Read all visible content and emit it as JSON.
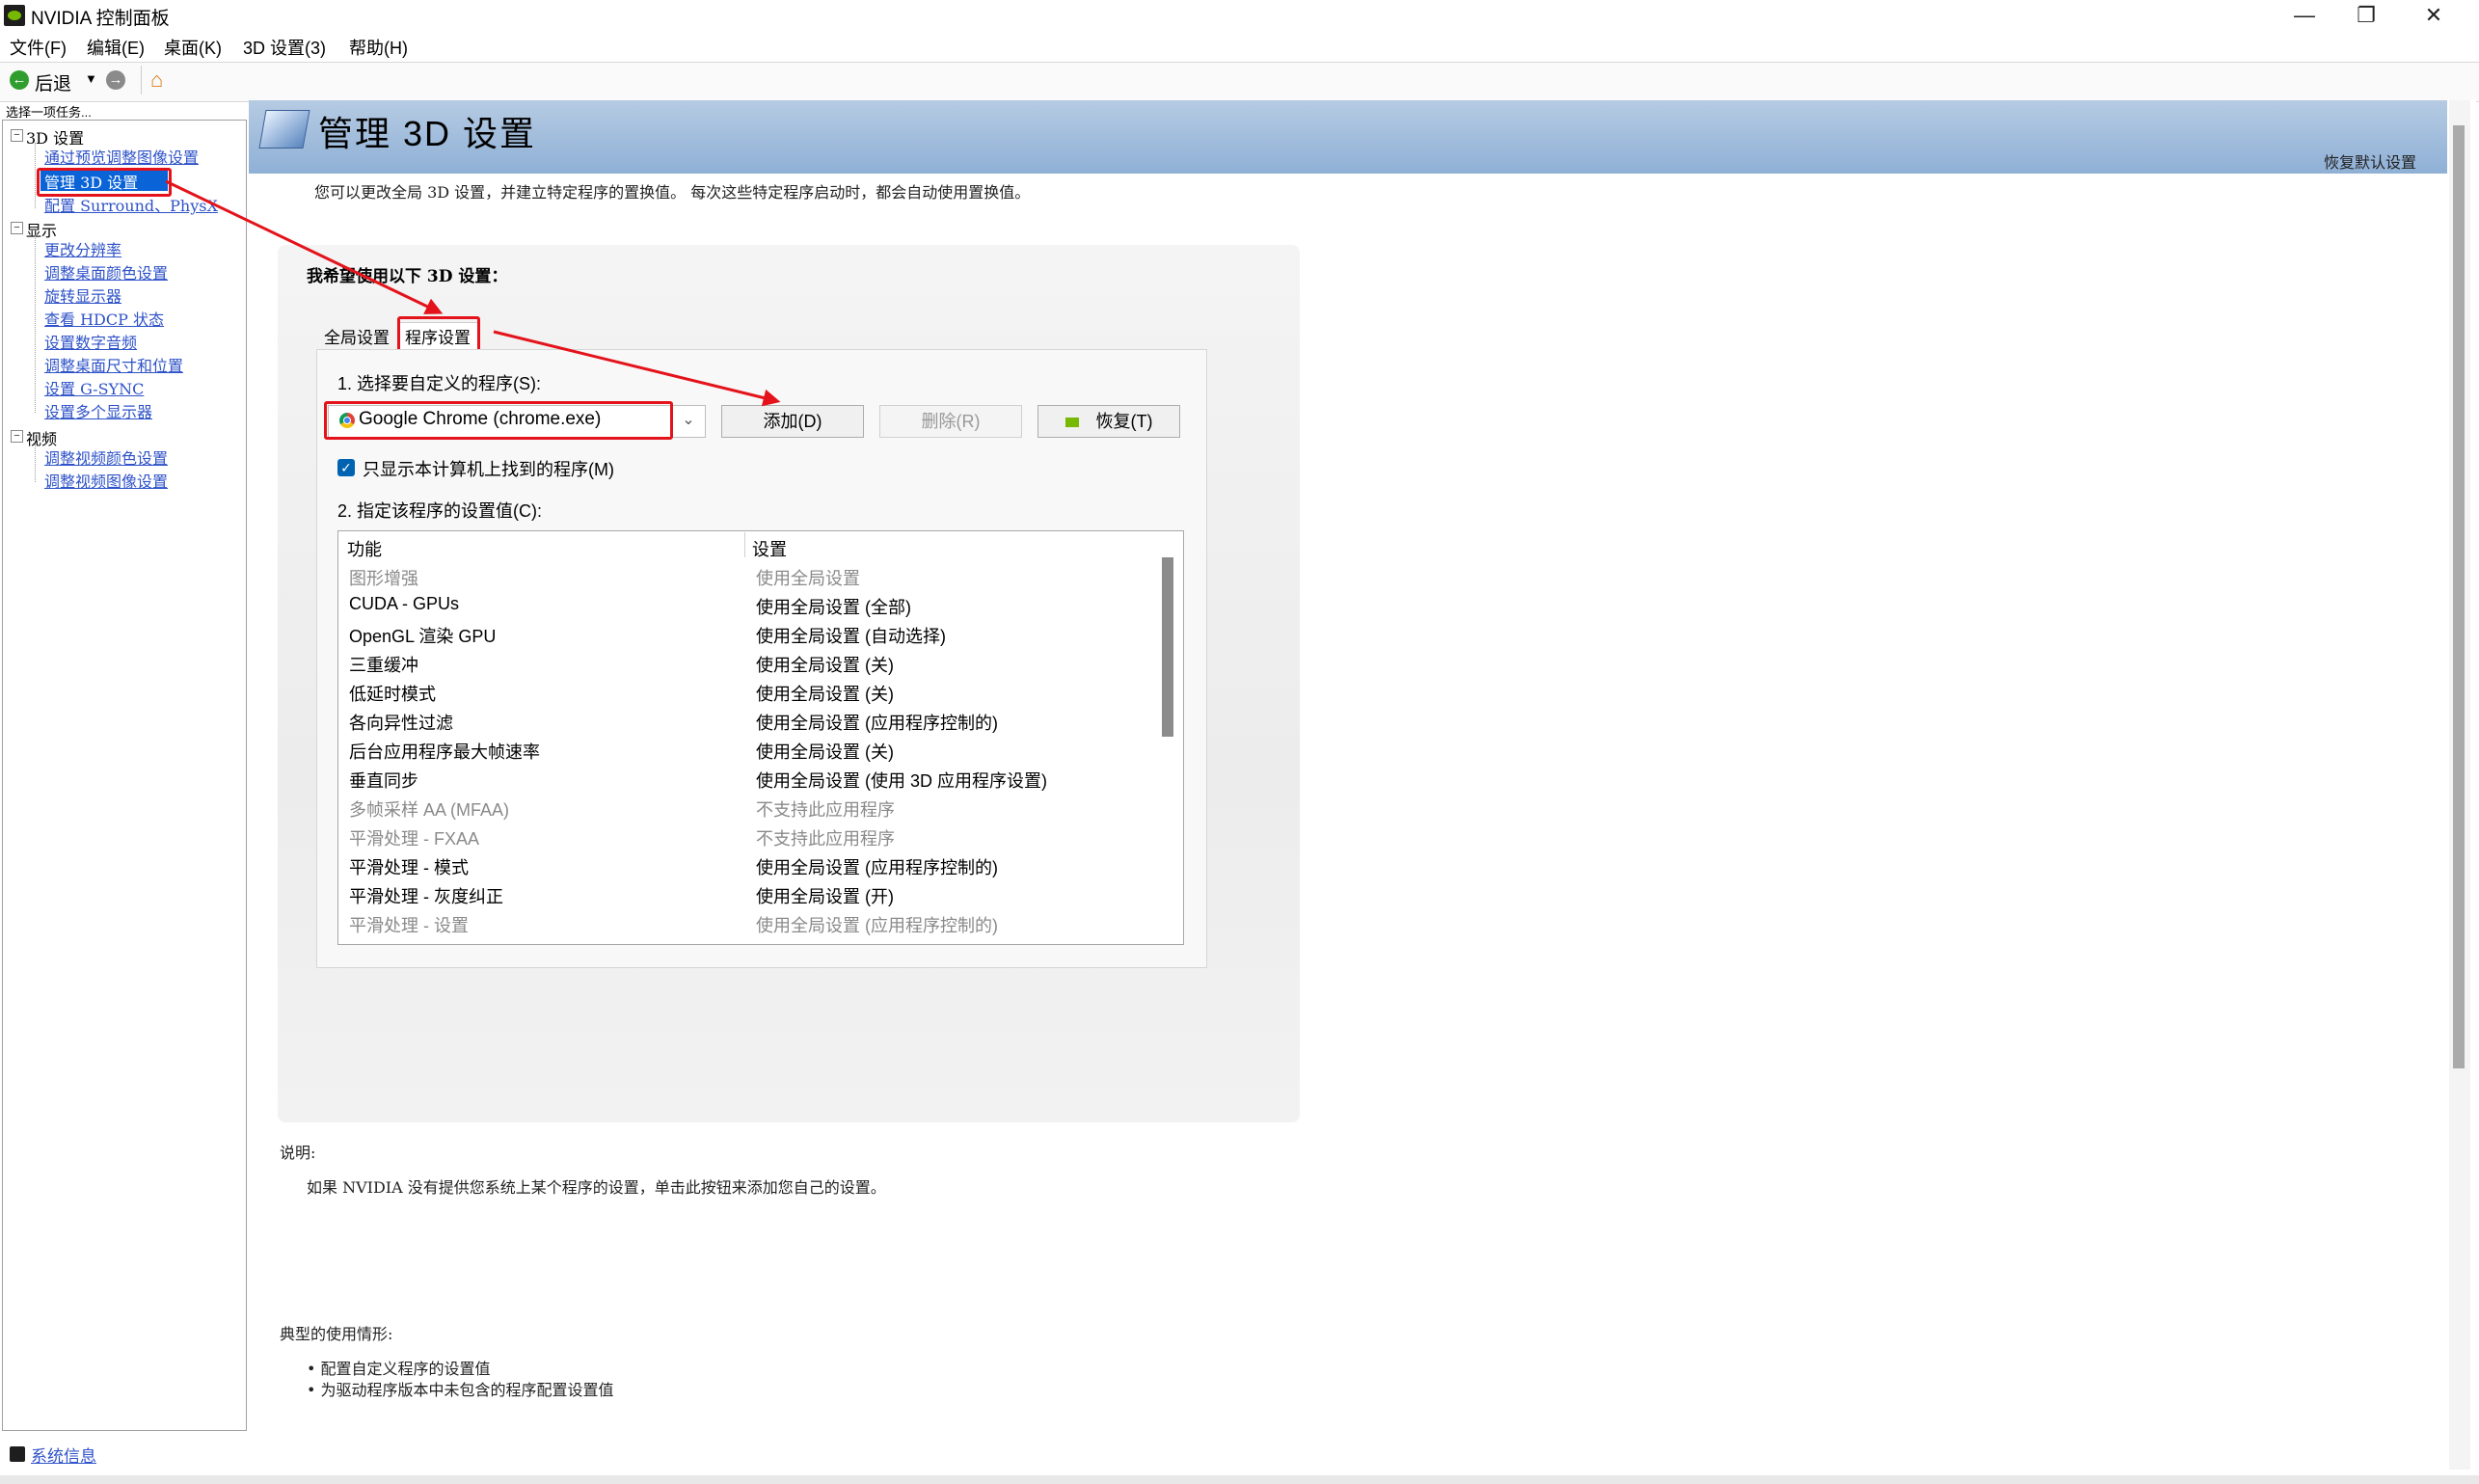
{
  "window": {
    "title": "NVIDIA 控制面板",
    "controls": {
      "minimize": "—",
      "maximize": "❐",
      "close": "✕"
    }
  },
  "menu": {
    "items": [
      "文件(F)",
      "编辑(E)",
      "桌面(K)",
      "3D 设置(3)",
      "帮助(H)"
    ]
  },
  "toolbar": {
    "back_label": "后退",
    "back_icon": "back-arrow-icon",
    "forward_icon": "forward-arrow-icon",
    "home_icon": "home-icon"
  },
  "sidebar": {
    "task_label": "选择一项任务...",
    "groups": [
      {
        "label": "3D 设置",
        "items": [
          "通过预览调整图像设置",
          "管理 3D 设置",
          "配置 Surround、PhysX"
        ]
      },
      {
        "label": "显示",
        "items": [
          "更改分辨率",
          "调整桌面颜色设置",
          "旋转显示器",
          "查看 HDCP 状态",
          "设置数字音频",
          "调整桌面尺寸和位置",
          "设置 G-SYNC",
          "设置多个显示器"
        ]
      },
      {
        "label": "视频",
        "items": [
          "调整视频颜色设置",
          "调整视频图像设置"
        ]
      }
    ],
    "system_info": "系统信息"
  },
  "page": {
    "title": "管理 3D 设置",
    "restore_defaults": "恢复默认设置",
    "description": "您可以更改全局 3D 设置，并建立特定程序的置换值。 每次这些特定程序启动时，都会自动使用置换值。",
    "prefer_label": "我希望使用以下 3D 设置：",
    "tabs": [
      "全局设置",
      "程序设置"
    ],
    "step1_label": "1. 选择要自定义的程序(S):",
    "selected_program": "Google Chrome (chrome.exe)",
    "add_button": "添加(D)",
    "delete_button": "删除(R)",
    "restore_button": "恢复(T)",
    "only_show_label": "只显示本计算机上找到的程序(M)",
    "only_show_checked": true,
    "step2_label": "2. 指定该程序的设置值(C):",
    "grid": {
      "headers": [
        "功能",
        "设置"
      ],
      "rows": [
        {
          "feature": "图形增强",
          "setting": "使用全局设置",
          "disabled": true
        },
        {
          "feature": "CUDA - GPUs",
          "setting": "使用全局设置 (全部)",
          "disabled": false
        },
        {
          "feature": "OpenGL 渲染 GPU",
          "setting": "使用全局设置 (自动选择)",
          "disabled": false
        },
        {
          "feature": "三重缓冲",
          "setting": "使用全局设置 (关)",
          "disabled": false
        },
        {
          "feature": "低延时模式",
          "setting": "使用全局设置 (关)",
          "disabled": false
        },
        {
          "feature": "各向异性过滤",
          "setting": "使用全局设置 (应用程序控制的)",
          "disabled": false
        },
        {
          "feature": "后台应用程序最大帧速率",
          "setting": "使用全局设置 (关)",
          "disabled": false
        },
        {
          "feature": "垂直同步",
          "setting": "使用全局设置 (使用 3D 应用程序设置)",
          "disabled": false
        },
        {
          "feature": "多帧采样 AA (MFAA)",
          "setting": "不支持此应用程序",
          "disabled": true
        },
        {
          "feature": "平滑处理 - FXAA",
          "setting": "不支持此应用程序",
          "disabled": true
        },
        {
          "feature": "平滑处理 - 模式",
          "setting": "使用全局设置 (应用程序控制的)",
          "disabled": false
        },
        {
          "feature": "平滑处理 - 灰度纠正",
          "setting": "使用全局设置 (开)",
          "disabled": false
        },
        {
          "feature": "平滑处理 - 设置",
          "setting": "使用全局设置 (应用程序控制的)",
          "disabled": true
        }
      ]
    },
    "explanation_title": "说明:",
    "explanation_text": "如果 NVIDIA 没有提供您系统上某个程序的设置，单击此按钮来添加您自己的设置。",
    "usage_title": "典型的使用情形:",
    "usage_items": [
      "配置自定义程序的设置值",
      "为驱动程序版本中未包含的程序配置设置值"
    ]
  },
  "colors": {
    "header_band": "#9db8dc",
    "link": "#2e52c8",
    "annotation_red": "#e4131b",
    "selected_item_bg": "#0a64d8"
  }
}
